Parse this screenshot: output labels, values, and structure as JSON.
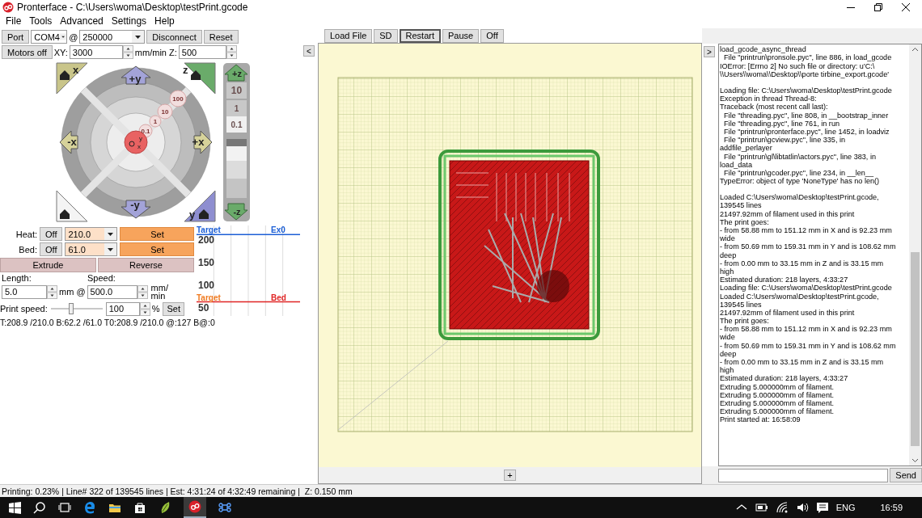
{
  "window": {
    "title": "Pronterface - C:\\Users\\woma\\Desktop\\testPrint.gcode"
  },
  "menu": [
    "File",
    "Tools",
    "Advanced",
    "Settings",
    "Help"
  ],
  "connection": {
    "port_button": "Port",
    "port": "COM4",
    "at": "@",
    "baud": "250000",
    "buttons": [
      "Disconnect",
      "Reset"
    ]
  },
  "motion": {
    "motors_off": "Motors off",
    "xy_label": "XY:",
    "xy_speed": "3000",
    "z_label": "mm/min Z:",
    "z_speed": "500"
  },
  "jog": {
    "xy_buttons": [
      "+y",
      "-x",
      "+x",
      "-y"
    ],
    "home_buttons": [
      "x",
      "z",
      "y"
    ],
    "center_labels": [
      "y",
      "x"
    ],
    "steps": [
      "100",
      "10",
      "1",
      "0.1"
    ],
    "z_buttons": [
      "+z",
      "-z"
    ],
    "z_steps": [
      "10",
      "1",
      "0.1"
    ]
  },
  "temperature": {
    "rows": [
      {
        "label": "Heat:",
        "off": "Off",
        "value": "210.0",
        "set": "Set"
      },
      {
        "label": "Bed:",
        "off": "Off",
        "value": "61.0",
        "set": "Set"
      }
    ],
    "chart_data": {
      "type": "line",
      "ylim": [
        30,
        230
      ],
      "yticks": [
        50,
        100,
        150,
        200
      ],
      "series": [
        {
          "name": "Ex0",
          "color": "#1c5fd6",
          "values": [
            210,
            210,
            210,
            210,
            210,
            210
          ]
        },
        {
          "name": "Bed",
          "color": "#e02424",
          "values": [
            61,
            61,
            61,
            61,
            61,
            61
          ]
        }
      ],
      "annotations": [
        {
          "text": "Target",
          "y": 210
        },
        {
          "text": "Target",
          "y": 61
        }
      ]
    }
  },
  "extrude": {
    "buttons": [
      "Extrude",
      "Reverse"
    ],
    "length_label": "Length:",
    "speed_label": "Speed:",
    "length": "5.0",
    "length_unit": "mm @",
    "speed": "500.0",
    "speed_unit": "mm/ min"
  },
  "print_speed": {
    "label": "Print speed:",
    "level": 0.4,
    "value": "100",
    "unit": "%",
    "set": "Set"
  },
  "temp_readout": "T:208.9 /210.0 B:62.2 /61.0 T0:208.9 /210.0 @:127 B@:0",
  "toolbar": {
    "collapse_left": "<",
    "buttons": [
      {
        "label": "Load File",
        "focused": false
      },
      {
        "label": "SD",
        "focused": false
      },
      {
        "label": "Restart",
        "focused": true
      },
      {
        "label": "Pause",
        "focused": false
      },
      {
        "label": "Off",
        "focused": false
      }
    ]
  },
  "canvas": {
    "zoom_button": "+"
  },
  "console": {
    "expand_button": ">",
    "blocks": [
      [
        "load_gcode_async_thread",
        "  File \"printrun\\pronsole.pyc\", line 886, in load_gcode",
        "IOError: [Errno 2] No such file or directory: u'C:\\",
        "\\\\Users\\\\woma\\\\Desktop\\\\porte tirbine_export.gcode'"
      ],
      [
        "Loading file: C:\\Users\\woma\\Desktop\\testPrint.gcode",
        "Exception in thread Thread-8:",
        "Traceback (most recent call last):",
        "  File \"threading.pyc\", line 808, in __bootstrap_inner",
        "  File \"threading.pyc\", line 761, in run",
        "  File \"printrun\\pronterface.pyc\", line 1452, in loadviz",
        "  File \"printrun\\gcview.pyc\", line 335, in",
        "addfile_perlayer",
        "  File \"printrun\\gl\\libtatlin\\actors.pyc\", line 383, in",
        "load_data",
        "  File \"printrun\\gcoder.pyc\", line 234, in __len__",
        "TypeError: object of type 'NoneType' has no len()"
      ],
      [
        "Loaded C:\\Users\\woma\\Desktop\\testPrint.gcode,",
        "139545 lines",
        "21497.92mm of filament used in this print",
        "The print goes:",
        "- from 58.88 mm to 151.12 mm in X and is 92.23 mm",
        "wide",
        "- from 50.69 mm to 159.31 mm in Y and is 108.62 mm",
        "deep",
        "- from 0.00 mm to 33.15 mm in Z and is 33.15 mm",
        "high",
        "Estimated duration: 218 layers, 4:33:27",
        "Loading file: C:\\Users\\woma\\Desktop\\testPrint.gcode",
        "Loaded C:\\Users\\woma\\Desktop\\testPrint.gcode,",
        "139545 lines",
        "21497.92mm of filament used in this print",
        "The print goes:",
        "- from 58.88 mm to 151.12 mm in X and is 92.23 mm",
        "wide",
        "- from 50.69 mm to 159.31 mm in Y and is 108.62 mm",
        "deep",
        "- from 0.00 mm to 33.15 mm in Z and is 33.15 mm",
        "high",
        "Estimated duration: 218 layers, 4:33:27",
        "Extruding 5.000000mm of filament.",
        "Extruding 5.000000mm of filament.",
        "Extruding 5.000000mm of filament.",
        "Extruding 5.000000mm of filament.",
        "Print started at: 16:58:09"
      ]
    ],
    "send": "Send"
  },
  "status_bar": "Printing: 0.23% | Line# 322 of 139545 lines | Est: 4:31:24 of 4:32:49 remaining |  Z: 0.150 mm",
  "taskbar": {
    "language": "ENG",
    "time": "16:59"
  }
}
